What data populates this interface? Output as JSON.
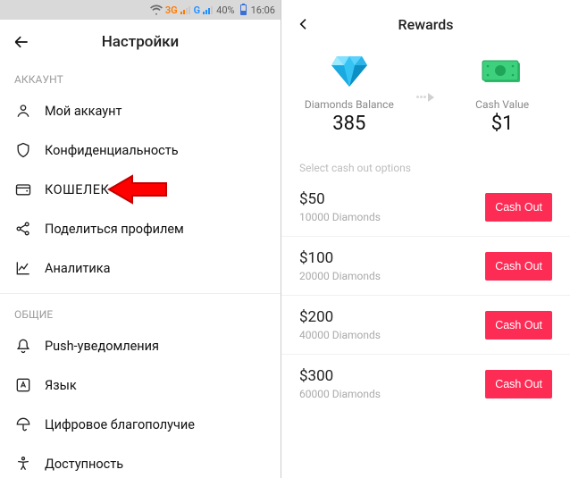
{
  "left": {
    "statusbar": {
      "net_a": "3G",
      "net_b": "G",
      "battery": "40%",
      "time": "16:06"
    },
    "header": {
      "title": "Настройки"
    },
    "section_account": "АККАУНТ",
    "items_account": [
      {
        "label": "Мой аккаунт"
      },
      {
        "label": "Конфиденциальность"
      },
      {
        "label": "КОШЕЛЕК"
      },
      {
        "label": "Поделиться профилем"
      },
      {
        "label": "Аналитика"
      }
    ],
    "section_general": "ОБЩИЕ",
    "items_general": [
      {
        "label": "Push-уведомления"
      },
      {
        "label": "Язык"
      },
      {
        "label": "Цифровое благополучие"
      },
      {
        "label": "Доступность"
      }
    ]
  },
  "right": {
    "header": {
      "title": "Rewards"
    },
    "balance": {
      "diamonds_label": "Diamonds Balance",
      "diamonds_value": "385",
      "cash_label": "Cash Value",
      "cash_value": "$1"
    },
    "select_note": "Select cash out options",
    "cashout_button": "Cash Out",
    "options": [
      {
        "amount": "$50",
        "diamonds": "10000 Diamonds"
      },
      {
        "amount": "$100",
        "diamonds": "20000 Diamonds"
      },
      {
        "amount": "$200",
        "diamonds": "40000 Diamonds"
      },
      {
        "amount": "$300",
        "diamonds": "60000 Diamonds"
      }
    ]
  },
  "colors": {
    "accent": "#fd2c55",
    "diamond": "#35c3f3",
    "cash": "#2cc06e"
  }
}
